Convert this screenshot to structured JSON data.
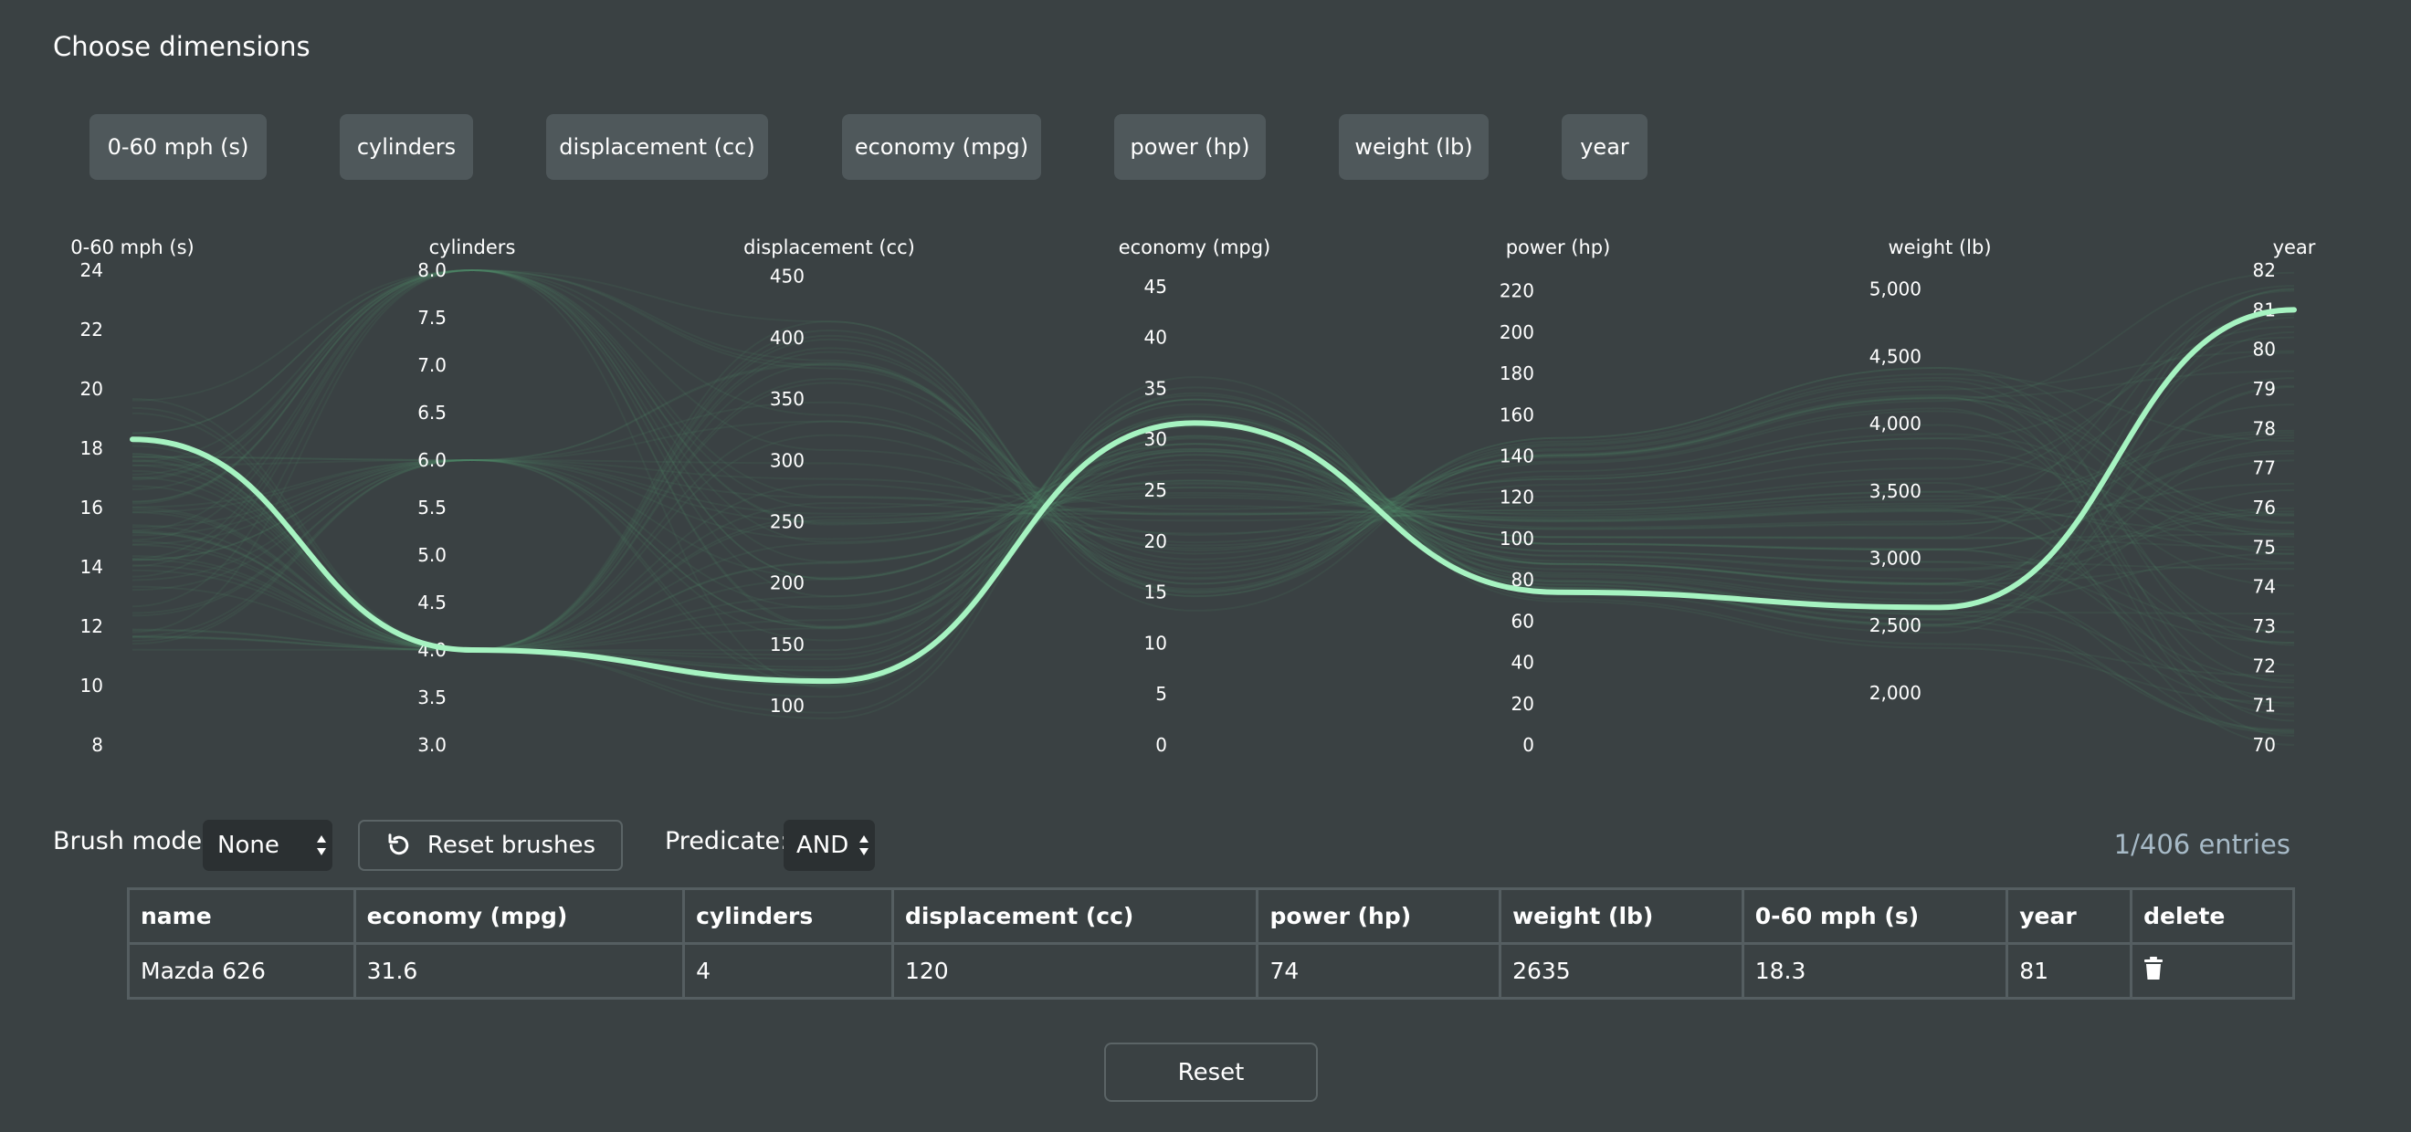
{
  "heading": "Choose dimensions",
  "dimension_buttons": [
    "0-60 mph (s)",
    "cylinders",
    "displacement (cc)",
    "economy (mpg)",
    "power (hp)",
    "weight (lb)",
    "year"
  ],
  "colors": {
    "background": "#3a4143",
    "highlight_line": "#a6f3c1",
    "faint_lines": "#4f8a68",
    "entries_text": "#a7bac7"
  },
  "chart_data": {
    "type": "parallel-coordinates",
    "axes": [
      {
        "label": "0-60 mph (s)",
        "range": [
          8,
          24
        ],
        "ticks": [
          "24",
          "22",
          "20",
          "18",
          "16",
          "14",
          "12",
          "10",
          "8"
        ]
      },
      {
        "label": "cylinders",
        "range": [
          3,
          8
        ],
        "ticks": [
          "8.0",
          "7.5",
          "7.0",
          "6.5",
          "6.0",
          "5.5",
          "5.0",
          "4.5",
          "4.0",
          "3.5",
          "3.0"
        ]
      },
      {
        "label": "displacement (cc)",
        "range": [
          68,
          455
        ],
        "ticks": [
          "450",
          "400",
          "350",
          "300",
          "250",
          "200",
          "150",
          "100"
        ]
      },
      {
        "label": "economy (mpg)",
        "range": [
          0,
          46.6
        ],
        "ticks": [
          "45",
          "40",
          "35",
          "30",
          "25",
          "20",
          "15",
          "10",
          "5",
          "0"
        ]
      },
      {
        "label": "power (hp)",
        "range": [
          0,
          230
        ],
        "ticks": [
          "220",
          "200",
          "180",
          "160",
          "140",
          "120",
          "100",
          "80",
          "60",
          "40",
          "20",
          "0"
        ]
      },
      {
        "label": "weight (lb)",
        "range": [
          1613,
          5140
        ],
        "ticks": [
          "5,000",
          "4,500",
          "4,000",
          "3,500",
          "3,000",
          "2,500",
          "2,000"
        ]
      },
      {
        "label": "year",
        "range": [
          70,
          82
        ],
        "ticks": [
          "82",
          "81",
          "80",
          "79",
          "78",
          "77",
          "76",
          "75",
          "74",
          "73",
          "72",
          "71",
          "70"
        ]
      }
    ],
    "highlighted": {
      "name": "Mazda 626",
      "values": [
        18.3,
        4,
        120,
        31.6,
        74,
        2635,
        81
      ]
    }
  },
  "controls": {
    "brush_mode_label": "Brush mode:",
    "brush_mode_value": "None",
    "reset_brushes_label": "Reset brushes",
    "predicate_label": "Predicate:",
    "predicate_value": "AND",
    "entries": "1/406 entries"
  },
  "table": {
    "headers": [
      "name",
      "economy (mpg)",
      "cylinders",
      "displacement (cc)",
      "power (hp)",
      "weight (lb)",
      "0-60 mph (s)",
      "year",
      "delete"
    ],
    "rows": [
      [
        "Mazda 626",
        "31.6",
        "4",
        "120",
        "74",
        "2635",
        "18.3",
        "81"
      ]
    ]
  },
  "reset_label": "Reset"
}
